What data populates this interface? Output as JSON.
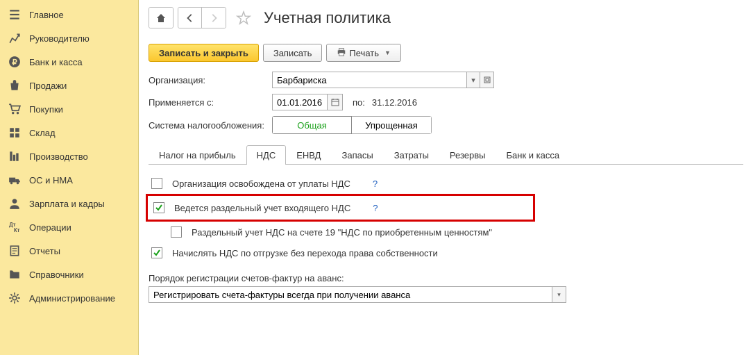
{
  "sidebar": {
    "items": [
      {
        "label": "Главное"
      },
      {
        "label": "Руководителю"
      },
      {
        "label": "Банк и касса"
      },
      {
        "label": "Продажи"
      },
      {
        "label": "Покупки"
      },
      {
        "label": "Склад"
      },
      {
        "label": "Производство"
      },
      {
        "label": "ОС и НМА"
      },
      {
        "label": "Зарплата и кадры"
      },
      {
        "label": "Операции"
      },
      {
        "label": "Отчеты"
      },
      {
        "label": "Справочники"
      },
      {
        "label": "Администрирование"
      }
    ]
  },
  "header": {
    "title": "Учетная политика"
  },
  "toolbar": {
    "save_close": "Записать и закрыть",
    "save": "Записать",
    "print": "Печать"
  },
  "form": {
    "org_label": "Организация:",
    "org_value": "Барбариска",
    "date_from_label": "Применяется с:",
    "date_from_value": "01.01.2016",
    "date_to_label": "по:",
    "date_to_value": "31.12.2016",
    "tax_system_label": "Система налогообложения:",
    "tax_system_general": "Общая",
    "tax_system_simplified": "Упрощенная"
  },
  "tabs": {
    "items": [
      {
        "label": "Налог на прибыль"
      },
      {
        "label": "НДС"
      },
      {
        "label": "ЕНВД"
      },
      {
        "label": "Запасы"
      },
      {
        "label": "Затраты"
      },
      {
        "label": "Резервы"
      },
      {
        "label": "Банк и касса"
      }
    ],
    "active_index": 1
  },
  "nds": {
    "exempt_label": "Организация освобождена от уплаты НДС",
    "separate_label": "Ведется раздельный учет входящего НДС",
    "separate_sub_label": "Раздельный учет НДС на счете 19 \"НДС по приобретенным ценностям\"",
    "accrue_label": "Начислять НДС по отгрузке без перехода права собственности",
    "help_q": "?",
    "invoice_order_label": "Порядок регистрации счетов-фактур на аванс:",
    "invoice_order_value": "Регистрировать счета-фактуры всегда при получении аванса"
  }
}
